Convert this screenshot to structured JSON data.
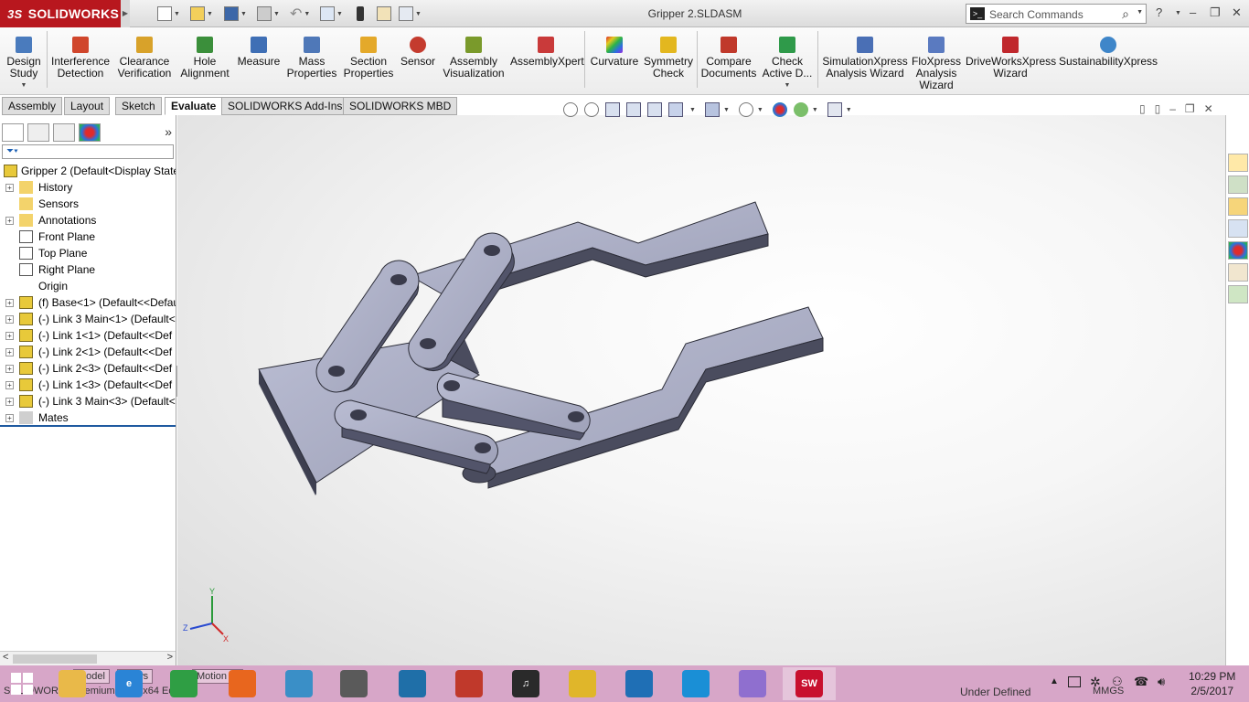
{
  "app": {
    "logo": "SOLIDWORKS",
    "logo_mark": "3S",
    "document_title": "Gripper 2.SLDASM",
    "search_placeholder": "Search Commands",
    "accent": "#b8171e"
  },
  "ribbon": {
    "buttons": [
      {
        "label_1": "Design",
        "label_2": "Study",
        "icon": "design-study-icon",
        "color": "#4a7bbd"
      },
      {
        "label_1": "Interference",
        "label_2": "Detection",
        "icon": "interference-icon",
        "color": "#d0462c"
      },
      {
        "label_1": "Clearance",
        "label_2": "Verification",
        "icon": "clearance-icon",
        "color": "#d8a22a"
      },
      {
        "label_1": "Hole",
        "label_2": "Alignment",
        "icon": "hole-alignment-icon",
        "color": "#3b8f3b"
      },
      {
        "label_1": "Measure",
        "label_2": "",
        "icon": "measure-icon",
        "color": "#3f6fb5"
      },
      {
        "label_1": "Mass",
        "label_2": "Properties",
        "icon": "mass-properties-icon",
        "color": "#4f78b8"
      },
      {
        "label_1": "Section",
        "label_2": "Properties",
        "icon": "section-properties-icon",
        "color": "#e4a92a"
      },
      {
        "label_1": "Sensor",
        "label_2": "",
        "icon": "sensor-icon",
        "color": "#c43b2e"
      },
      {
        "label_1": "Assembly",
        "label_2": "Visualization",
        "icon": "assembly-visualization-icon",
        "color": "#7a9a2b"
      },
      {
        "label_1": "AssemblyXpert",
        "label_2": "",
        "icon": "assemblyxpert-icon",
        "color": "#c93a3a"
      },
      {
        "label_1": "Curvature",
        "label_2": "",
        "icon": "curvature-icon",
        "color": "#8a3bbf"
      },
      {
        "label_1": "Symmetry",
        "label_2": "Check",
        "icon": "symmetry-check-icon",
        "color": "#e3b71f"
      },
      {
        "label_1": "Compare",
        "label_2": "Documents",
        "icon": "compare-documents-icon",
        "color": "#c0392b"
      },
      {
        "label_1": "Check",
        "label_2": "Active D...",
        "icon": "check-active-document-icon",
        "color": "#2f9a4a"
      },
      {
        "label_1": "SimulationXpress",
        "label_2": "Analysis Wizard",
        "icon": "simulationxpress-icon",
        "color": "#4a6fb5"
      },
      {
        "label_1": "FloXpress",
        "label_2": "Analysis",
        "label_3": "Wizard",
        "icon": "floxpress-icon",
        "color": "#5a7ac0"
      },
      {
        "label_1": "DriveWorksXpress",
        "label_2": "Wizard",
        "icon": "driveworksxpress-icon",
        "color": "#c0282d"
      },
      {
        "label_1": "SustainabilityXpress",
        "label_2": "",
        "icon": "sustainabilityxpress-icon",
        "color": "#3f86c9"
      }
    ]
  },
  "tabs": [
    "Assembly",
    "Layout",
    "Sketch",
    "Evaluate",
    "SOLIDWORKS Add-Ins",
    "SOLIDWORKS MBD"
  ],
  "active_tab": "Evaluate",
  "feature_tree": {
    "root": "Gripper 2  (Default<Display State",
    "items": [
      {
        "label": "History",
        "expandable": true,
        "icon": "history-icon"
      },
      {
        "label": "Sensors",
        "expandable": false,
        "icon": "sensors-icon"
      },
      {
        "label": "Annotations",
        "expandable": true,
        "icon": "annotations-icon"
      },
      {
        "label": "Front Plane",
        "expandable": false,
        "icon": "plane-icon"
      },
      {
        "label": "Top Plane",
        "expandable": false,
        "icon": "plane-icon"
      },
      {
        "label": "Right Plane",
        "expandable": false,
        "icon": "plane-icon"
      },
      {
        "label": "Origin",
        "expandable": false,
        "icon": "origin-icon"
      },
      {
        "label": "(f) Base<1> (Default<<Defau",
        "expandable": true,
        "icon": "part-icon"
      },
      {
        "label": "(-) Link 3 Main<1> (Default<",
        "expandable": true,
        "icon": "part-icon"
      },
      {
        "label": "(-) Link 1<1> (Default<<Def",
        "expandable": true,
        "icon": "part-icon"
      },
      {
        "label": "(-) Link 2<1> (Default<<Def",
        "expandable": true,
        "icon": "part-icon"
      },
      {
        "label": "(-) Link 2<3> (Default<<Def",
        "expandable": true,
        "icon": "part-icon"
      },
      {
        "label": "(-) Link 1<3> (Default<<Def",
        "expandable": true,
        "icon": "part-icon"
      },
      {
        "label": "(-) Link 3 Main<3> (Default<",
        "expandable": true,
        "icon": "part-icon"
      },
      {
        "label": "Mates",
        "expandable": true,
        "icon": "mates-icon"
      }
    ]
  },
  "triad": {
    "y": "Y",
    "z": "Z",
    "x": "X"
  },
  "bottom_tabs": [
    "Model",
    "Views",
    "Motion St"
  ],
  "status": {
    "left": "SOLIDWORKS Premium 2015 x64 Ed",
    "state": "Under Defined",
    "units": "MMGS"
  },
  "taskbar": {
    "apps": [
      {
        "name": "file-explorer",
        "color": "#e9b949",
        "label": ""
      },
      {
        "name": "internet-explorer",
        "color": "#2a84d6",
        "label": "e"
      },
      {
        "name": "store",
        "color": "#2f9e44",
        "label": ""
      },
      {
        "name": "firefox",
        "color": "#e8661e",
        "label": ""
      },
      {
        "name": "dvd-player",
        "color": "#3a8fc7",
        "label": ""
      },
      {
        "name": "settings-laptop",
        "color": "#5a5a5a",
        "label": ""
      },
      {
        "name": "video",
        "color": "#1f6fa8",
        "label": ""
      },
      {
        "name": "media-app",
        "color": "#c0392b",
        "label": ""
      },
      {
        "name": "itunes",
        "color": "#2a2a2a",
        "label": "♫"
      },
      {
        "name": "chrome",
        "color": "#e0b62a",
        "label": ""
      },
      {
        "name": "dolphin-app",
        "color": "#1f6fb5",
        "label": ""
      },
      {
        "name": "wifi",
        "color": "#1a8fd6",
        "label": ""
      },
      {
        "name": "paint",
        "color": "#8f6fcf",
        "label": ""
      },
      {
        "name": "solidworks-2015",
        "color": "#c8102e",
        "label": "SW"
      }
    ],
    "time": "10:29 PM",
    "date": "2/5/2017"
  }
}
